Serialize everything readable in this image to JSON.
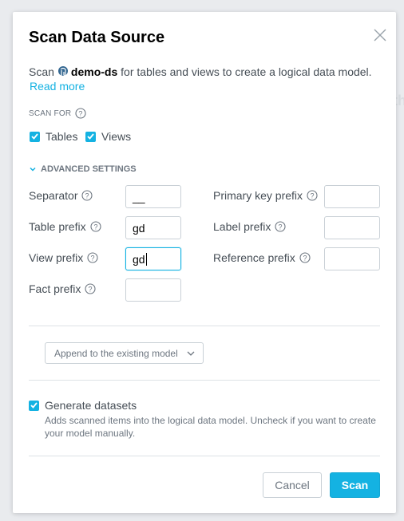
{
  "background": {
    "ghost_text": "th"
  },
  "dialog": {
    "title": "Scan Data Source",
    "description_prefix": "Scan",
    "data_source_name": "demo-ds",
    "description_suffix": "for tables and views to create a logical data model.",
    "read_more": "Read more",
    "scan_for_label": "SCAN FOR",
    "checkboxes": [
      {
        "label": "Tables",
        "checked": true
      },
      {
        "label": "Views",
        "checked": true
      }
    ],
    "advanced_settings_label": "ADVANCED SETTINGS",
    "fields": {
      "separator": {
        "label": "Separator",
        "value": "__"
      },
      "table_prefix": {
        "label": "Table prefix",
        "value": "gd"
      },
      "view_prefix": {
        "label": "View prefix",
        "value": "gd"
      },
      "fact_prefix": {
        "label": "Fact prefix",
        "value": ""
      },
      "primary_key_prefix": {
        "label": "Primary key prefix",
        "value": ""
      },
      "label_prefix": {
        "label": "Label prefix",
        "value": ""
      },
      "reference_prefix": {
        "label": "Reference prefix",
        "value": ""
      }
    },
    "mode_dropdown": {
      "selected": "Append to the existing model"
    },
    "generate_datasets": {
      "label": "Generate datasets",
      "checked": true,
      "description": "Adds scanned items into the logical data model. Uncheck if you want to create your model manually."
    },
    "buttons": {
      "cancel": "Cancel",
      "scan": "Scan"
    }
  },
  "colors": {
    "accent": "#14b2e2",
    "text": "#464e56",
    "muted": "#6d7680",
    "border": "#c9d0d6"
  }
}
